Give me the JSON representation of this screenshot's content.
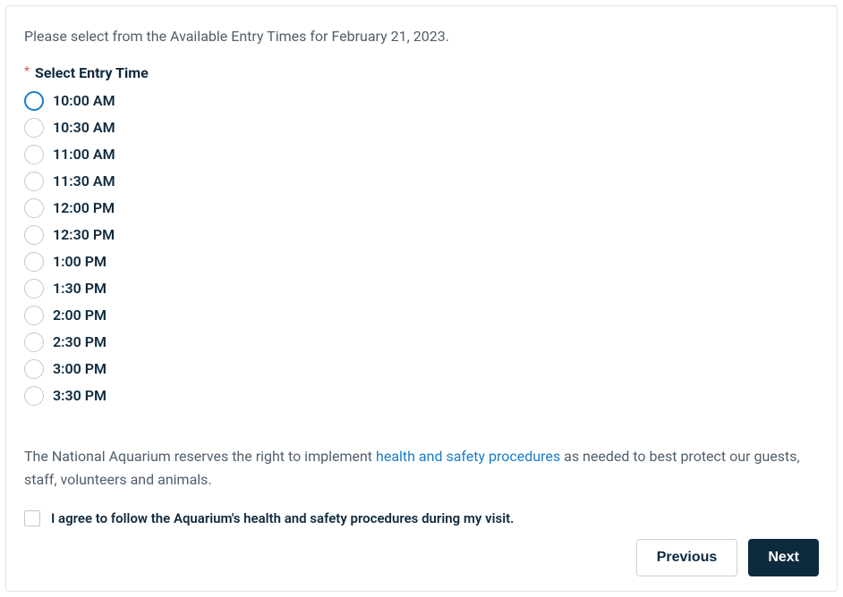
{
  "instruction": "Please select from the Available Entry Times for February 21, 2023.",
  "field": {
    "label": "Select Entry Time",
    "required_marker": "*"
  },
  "entry_times": [
    {
      "label": "10:00 AM",
      "focused": true
    },
    {
      "label": "10:30 AM",
      "focused": false
    },
    {
      "label": "11:00 AM",
      "focused": false
    },
    {
      "label": "11:30 AM",
      "focused": false
    },
    {
      "label": "12:00 PM",
      "focused": false
    },
    {
      "label": "12:30 PM",
      "focused": false
    },
    {
      "label": "1:00 PM",
      "focused": false
    },
    {
      "label": "1:30 PM",
      "focused": false
    },
    {
      "label": "2:00 PM",
      "focused": false
    },
    {
      "label": "2:30 PM",
      "focused": false
    },
    {
      "label": "3:00 PM",
      "focused": false
    },
    {
      "label": "3:30 PM",
      "focused": false
    }
  ],
  "disclaimer": {
    "prefix": "The National Aquarium reserves the right to implement ",
    "link_text": "health and safety procedures",
    "suffix": " as needed to best protect our guests, staff, volunteers and animals."
  },
  "agree": {
    "label": "I agree to follow the Aquarium's health and safety procedures during my visit.",
    "checked": false
  },
  "buttons": {
    "previous": "Previous",
    "next": "Next"
  }
}
